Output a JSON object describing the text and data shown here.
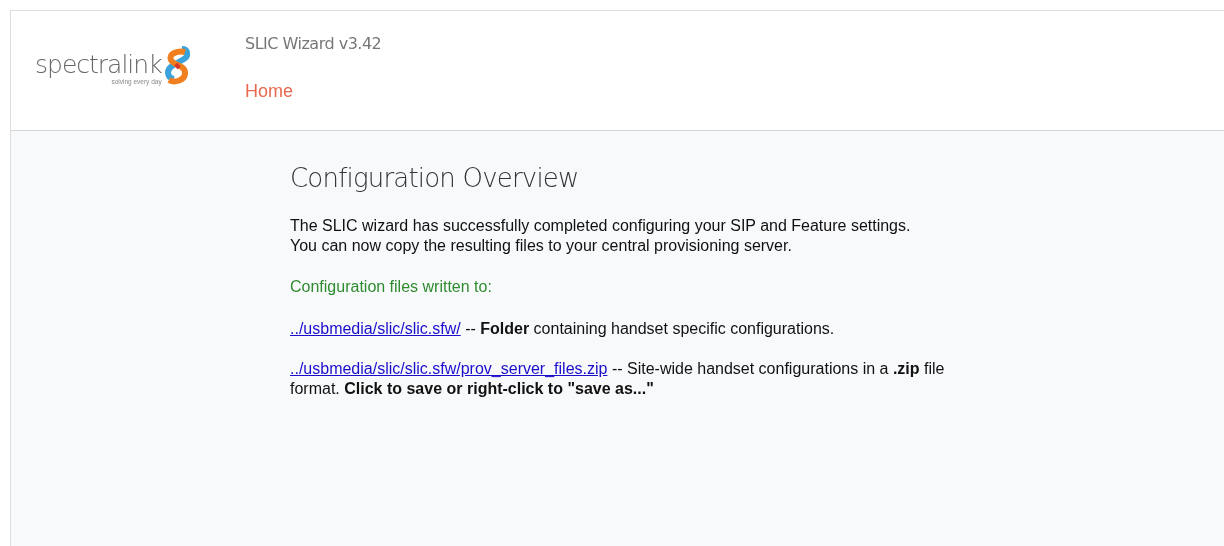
{
  "logo": {
    "wordmark": "spectralink",
    "tagline": "solving every day"
  },
  "header": {
    "title": "SLIC Wizard v3.42",
    "nav_link": "Home"
  },
  "main": {
    "heading": "Configuration Overview",
    "intro": [
      "The SLIC wizard has successfully completed configuring your SIP and Feature settings.",
      "You can now copy the resulting files to your central provisioning server."
    ],
    "files_label": "Configuration files written to:",
    "files": [
      {
        "link": "../usbmedia/slic/slic.sfw/",
        "description": " -- **Folder** containing handset specific configurations."
      },
      {
        "link": "../usbmedia/slic/slic.sfw/prov_server_files.zip",
        "description": " -- Site-wide handset configurations in a **.zip** file format. **Click to save or right-click to \"save as...\"**"
      }
    ]
  }
}
